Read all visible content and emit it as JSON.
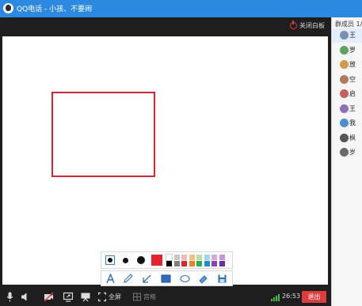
{
  "window": {
    "title": "QQ电话 - 小孩、不要闹"
  },
  "whiteboard": {
    "close_label": "关闭白板"
  },
  "palette": {
    "current_color": "#e8212f",
    "swatches_row1": [
      "#ffffff",
      "#c7c7c7",
      "#f4b9b2",
      "#f5c27e",
      "#b7e0a3",
      "#9cd9e7",
      "#d7a8e0",
      "#c792e6"
    ],
    "swatches_row2": [
      "#000000",
      "#7f7f7f",
      "#e8212f",
      "#f07c23",
      "#24b24a",
      "#1f8bd4",
      "#8a3fc4",
      "#6a2ca8"
    ]
  },
  "tools": [
    "text-tool",
    "pen-tool",
    "arrow-tool",
    "rectangle-tool",
    "ellipse-tool",
    "eraser-tool",
    "save-tool"
  ],
  "bottombar": {
    "fullscreen_label": "全屏",
    "grid_label": "宫格",
    "time": "26:53",
    "exit_label": "退出"
  },
  "members": {
    "header": "群成员 1/9",
    "items": [
      {
        "name": "王",
        "avatar": "#7b8fb0"
      },
      {
        "name": "罗",
        "avatar": "#5fa35f"
      },
      {
        "name": "放",
        "avatar": "#d49a4a"
      },
      {
        "name": "空",
        "avatar": "#b07a5a"
      },
      {
        "name": "启",
        "avatar": "#c46060"
      },
      {
        "name": "王",
        "avatar": "#8a70b8"
      },
      {
        "name": "我",
        "avatar": "#4f8fcf"
      },
      {
        "name": "枫",
        "avatar": "#555555"
      },
      {
        "name": "岁",
        "avatar": "#6a6a6a"
      }
    ]
  }
}
